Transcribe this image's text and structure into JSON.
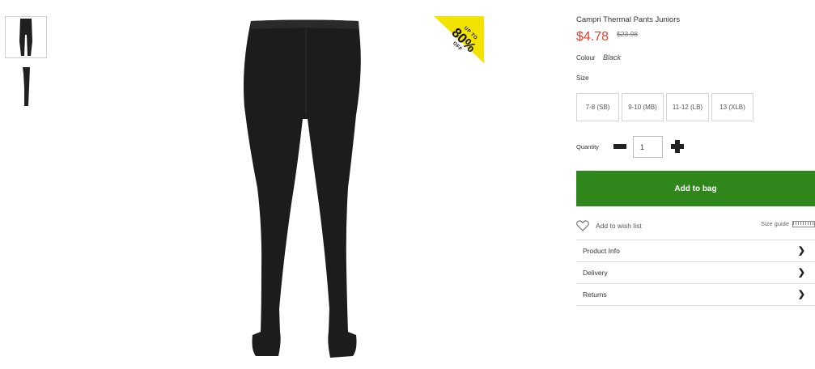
{
  "product": {
    "title": "Campri Thermal Pants Juniors",
    "price": "$4.78",
    "was_price": "$23.98",
    "colour_label": "Colour",
    "colour_value": "Black"
  },
  "promo": {
    "small": "UP TO",
    "big": "80%",
    "off": "OFF"
  },
  "size": {
    "label": "Size",
    "options": [
      "7-8 (SB)",
      "9-10 (MB)",
      "11-12 (LB)",
      "13 (XLB)"
    ]
  },
  "quantity": {
    "label": "Quantity",
    "value": "1"
  },
  "actions": {
    "add_to_bag": "Add to bag",
    "wishlist": "Add to wish list",
    "size_guide": "Size guide"
  },
  "accordion": [
    "Product Info",
    "Delivery",
    "Returns"
  ],
  "colors": {
    "price": "#e63e2a",
    "add_to_bag": "#2f871b",
    "promo": "#f3e300"
  }
}
